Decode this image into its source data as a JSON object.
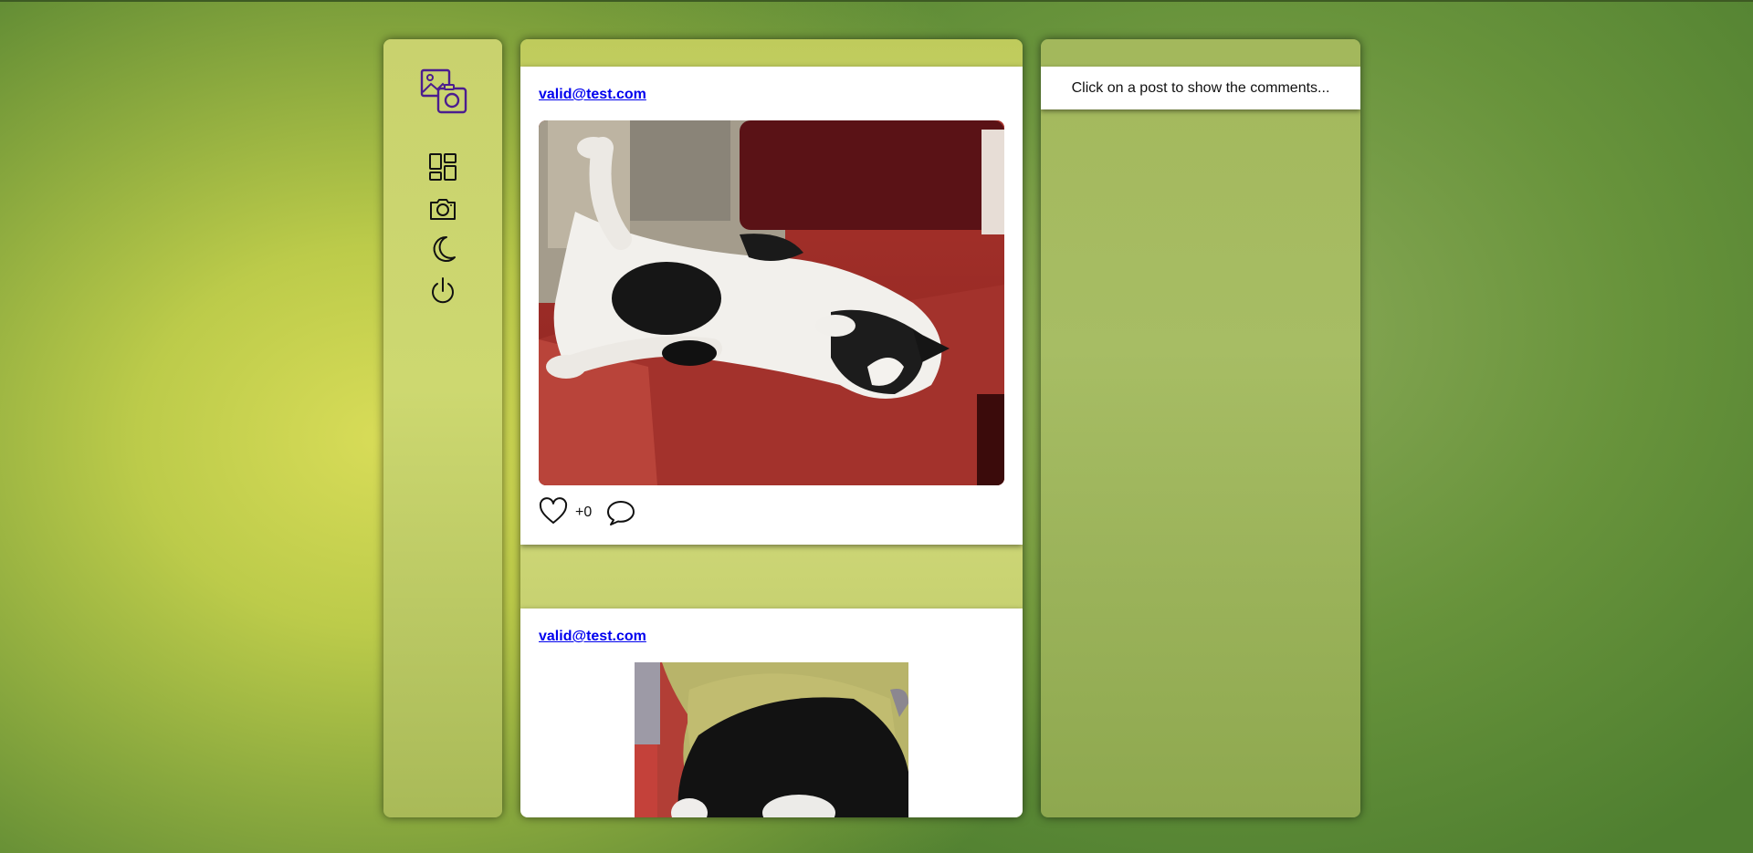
{
  "app": {
    "logo_icon": "photo-camera-logo-icon",
    "accent": "#4b1d8f"
  },
  "sidebar": {
    "items": [
      {
        "name": "dashboard",
        "icon": "dashboard-grid-icon"
      },
      {
        "name": "camera",
        "icon": "camera-icon"
      },
      {
        "name": "dark-mode",
        "icon": "moon-icon"
      },
      {
        "name": "logout",
        "icon": "power-icon"
      }
    ]
  },
  "feed": {
    "posts": [
      {
        "author": "valid@test.com",
        "likes": "+0",
        "image": "cat-on-red-couch"
      },
      {
        "author": "valid@test.com",
        "image": "cat-on-blanket"
      }
    ]
  },
  "comments": {
    "hint": "Click on a post to show the comments..."
  },
  "colors": {
    "link": "#0000ee",
    "post_background": "#ffffff"
  }
}
